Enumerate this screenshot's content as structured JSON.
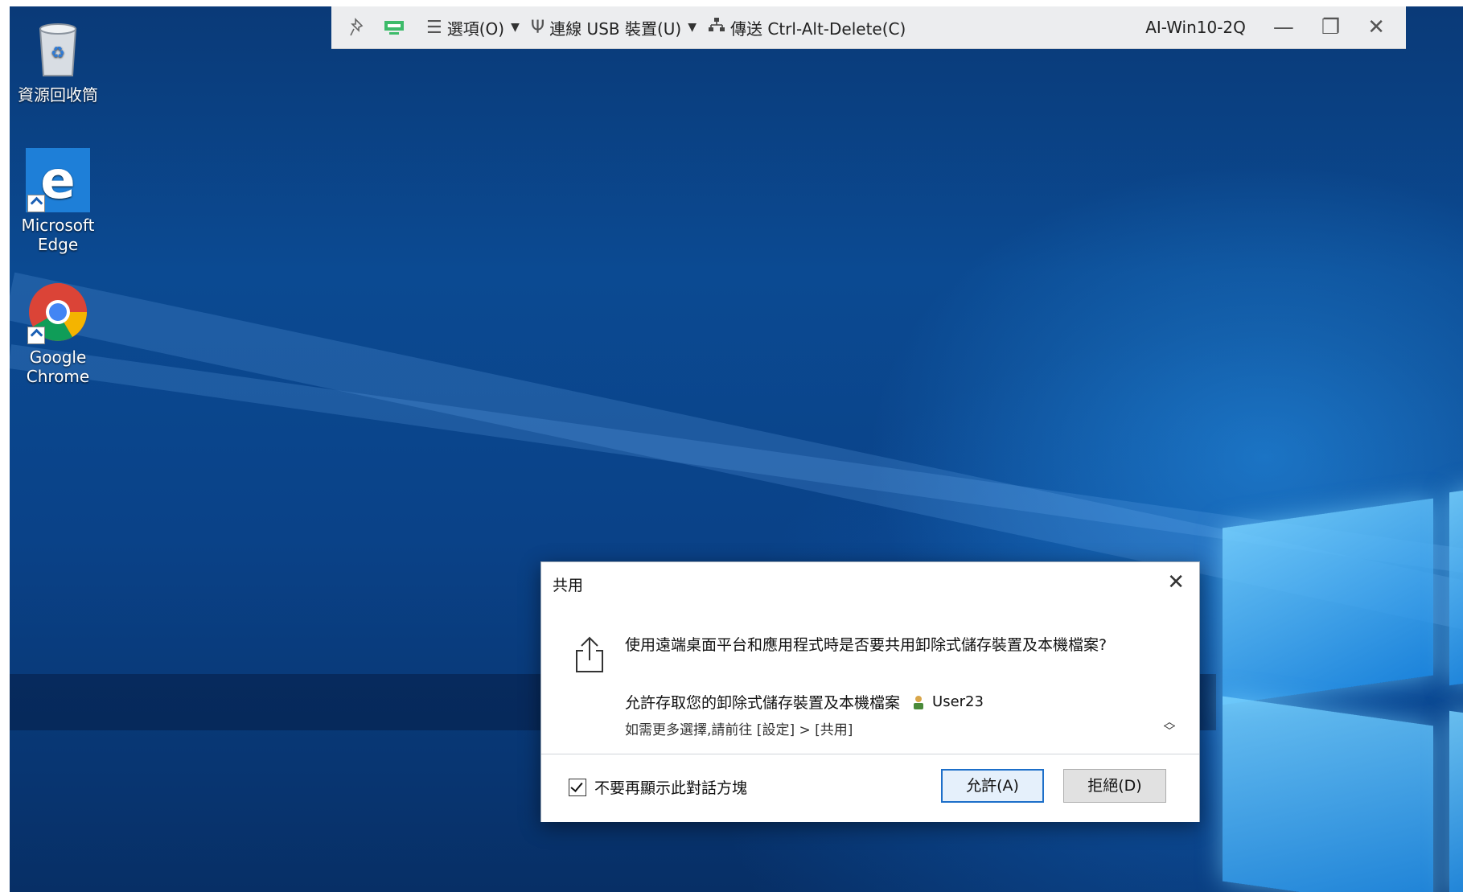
{
  "toolbar": {
    "options_label": "選項(O)",
    "usb_label": "連線 USB 裝置(U)",
    "cad_label": "傳送 Ctrl-Alt-Delete(C)",
    "machine_name": "AI-Win10-2Q",
    "icons": [
      "pin-icon",
      "display-icon",
      "menu-icon",
      "usb-icon",
      "network-icon",
      "minimize-icon",
      "restore-icon",
      "close-icon"
    ]
  },
  "desktop": {
    "icons": [
      {
        "label": "資源回收筒",
        "icon": "recycle-bin-icon"
      },
      {
        "label": "Microsoft Edge",
        "icon": "edge-icon"
      },
      {
        "label": "Google Chrome",
        "icon": "chrome-icon"
      }
    ]
  },
  "dialog": {
    "title": "共用",
    "question": "使用遠端桌面平台和應用程式時是否要共用卸除式儲存裝置及本機檔案?",
    "allow_text": "允許存取您的卸除式儲存裝置及本機檔案",
    "user_name": "User23",
    "hint": "如需更多選擇,請前往 [設定] > [共用]",
    "checkbox_label": "不要再顯示此對話方塊",
    "checkbox_checked": true,
    "allow_button": "允許(A)",
    "deny_button": "拒絕(D)"
  },
  "colors": {
    "accent": "#1d6fc9",
    "toolbar_bg": "#ecedef",
    "desktop_blue": "#0b4a92"
  }
}
